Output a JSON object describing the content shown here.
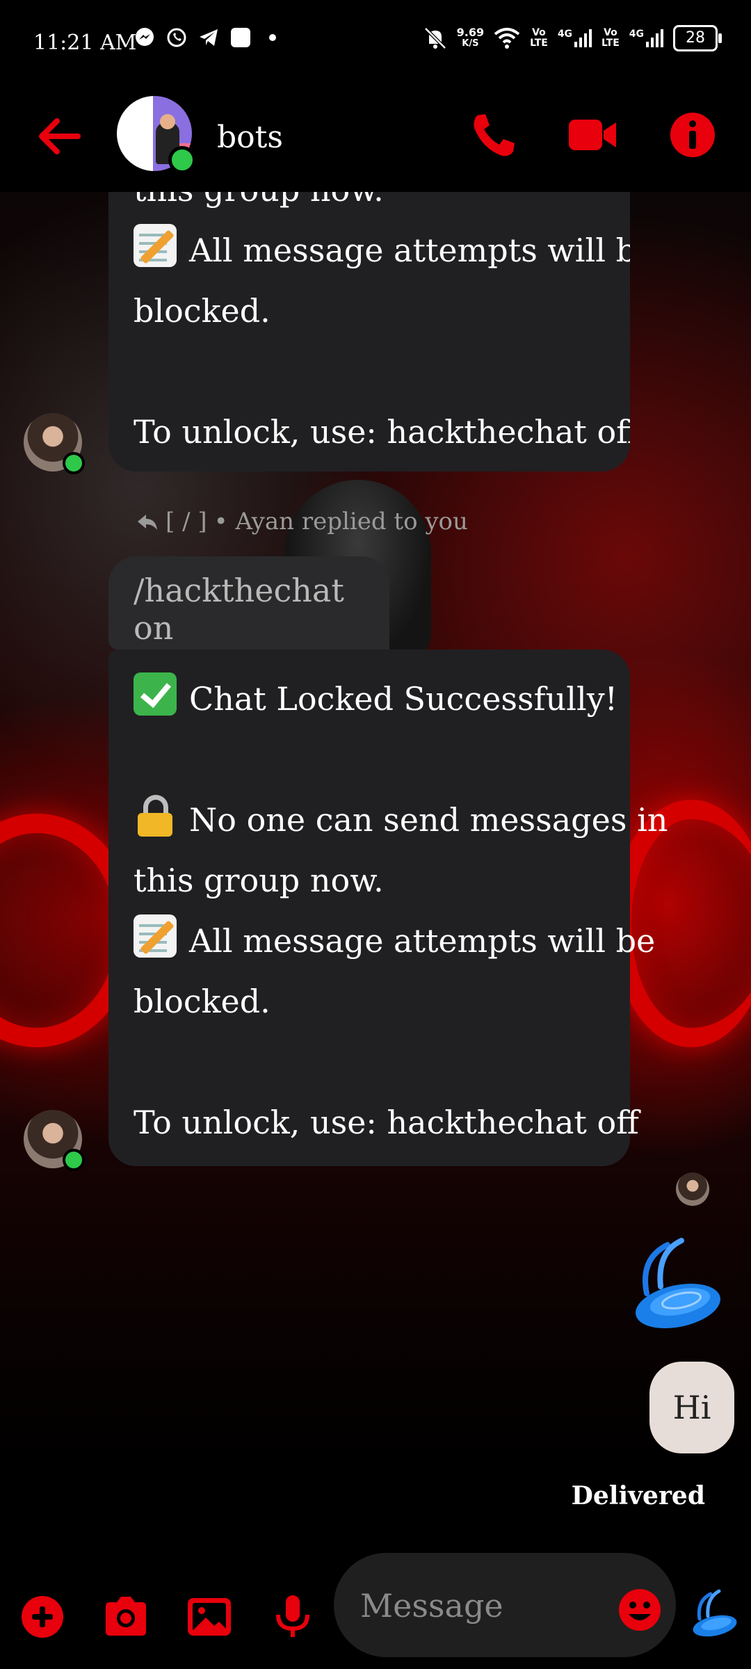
{
  "status_bar": {
    "time": "11:21 AM",
    "apps": [
      "messenger-icon",
      "whatsapp-icon",
      "telegram-icon",
      "app-square-icon",
      "dot-icon"
    ],
    "net_speed_value": "9.69",
    "net_speed_unit": "K/S",
    "sim1_label_top": "Vo",
    "sim1_label_bottom": "LTE",
    "sim1_gen": "4G",
    "sim2_label_top": "Vo",
    "sim2_label_bottom": "LTE",
    "sim2_gen": "4G",
    "battery": "28"
  },
  "header": {
    "title": "bots",
    "accent_color": "#e8000c"
  },
  "messages": {
    "first_bubble": {
      "lines": [
        "this group now.",
        "All message attempts will be",
        "blocked.",
        "",
        "To unlock, use: hackthechat off"
      ]
    },
    "reply_meta": {
      "quote_symbol": "[ / ]",
      "text": "• Ayan replied to you"
    },
    "quoted_text": "/hackthechat on",
    "second_bubble": {
      "lines": [
        "Chat Locked Successfully!",
        "",
        "No one can send messages in",
        "this group now.",
        "All message attempts will be",
        "blocked.",
        "",
        "To unlock, use: hackthechat off"
      ]
    },
    "outgoing": {
      "text": "Hi",
      "status": "Delivered"
    }
  },
  "composer": {
    "placeholder": "Message"
  }
}
